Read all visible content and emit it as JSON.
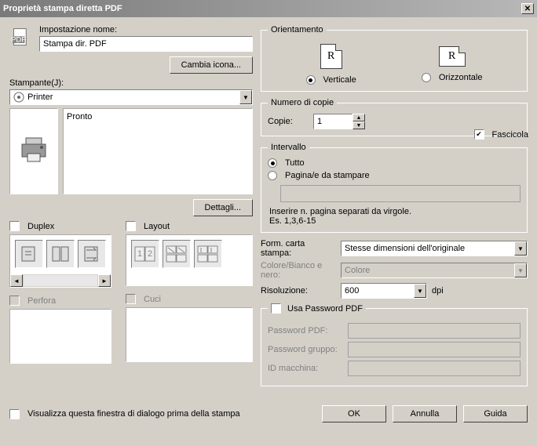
{
  "title": "Proprietà stampa diretta PDF",
  "left": {
    "setting_name_label": "Impostazione nome:",
    "setting_name_value": "Stampa dir. PDF",
    "change_icon_btn": "Cambia icona...",
    "printer_label": "Stampante(J):",
    "printer_value": "Printer",
    "printer_status": "Pronto",
    "details_btn": "Dettagli...",
    "duplex_label": "Duplex",
    "layout_label": "Layout",
    "perfora_label": "Perfora",
    "cuci_label": "Cuci"
  },
  "orient": {
    "legend": "Orientamento",
    "r_glyph": "R",
    "vertical": "Verticale",
    "horizontal": "Orizzontale"
  },
  "copies": {
    "legend": "Numero di copie",
    "label": "Copie:",
    "value": "1",
    "collate": "Fascicola"
  },
  "range": {
    "legend": "Intervallo",
    "all": "Tutto",
    "pages": "Pagina/e da stampare",
    "hint1": "Inserire n. pagina separati da virgole.",
    "hint2": "Es. 1,3,6-15"
  },
  "paper": {
    "label": "Form. carta stampa:",
    "value": "Stesse dimensioni dell'originale"
  },
  "color": {
    "label": "Colore/Bianco e nero:",
    "value": "Colore"
  },
  "res": {
    "label": "Risoluzione:",
    "value": "600",
    "unit": "dpi"
  },
  "pwd": {
    "legend": "Usa Password PDF",
    "pdf": "Password PDF:",
    "group": "Password gruppo:",
    "machine": "ID macchina:"
  },
  "footer": {
    "show_dialog": "Visualizza questa finestra di dialogo prima della stampa",
    "ok": "OK",
    "cancel": "Annulla",
    "help": "Guida"
  }
}
